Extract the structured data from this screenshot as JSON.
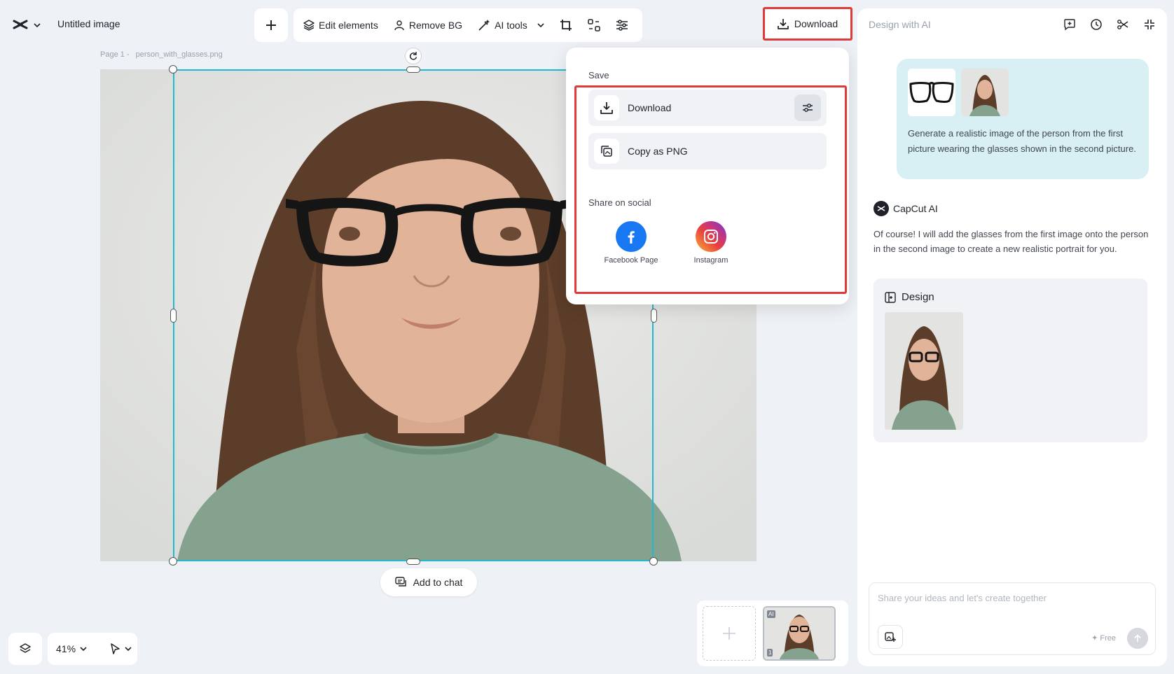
{
  "header": {
    "title": "Untitled image",
    "toolbar": {
      "edit_elements": "Edit elements",
      "remove_bg": "Remove BG",
      "ai_tools": "AI tools"
    },
    "download_label": "Download"
  },
  "canvas": {
    "page_label": "Page 1 -",
    "file_name": "person_with_glasses.png",
    "add_to_chat": "Add to chat"
  },
  "bottom": {
    "zoom": "41%"
  },
  "thumbs": {
    "badge_ai": "AI",
    "badge_num": "1"
  },
  "download_menu": {
    "save_heading": "Save",
    "download": "Download",
    "copy_png": "Copy as PNG",
    "share_heading": "Share on social",
    "facebook": "Facebook Page",
    "instagram": "Instagram"
  },
  "panel": {
    "title": "Design with AI",
    "user_message": "Generate a realistic image of the person from the first picture wearing the glasses shown in the second picture.",
    "ai_name": "CapCut AI",
    "ai_message": "Of course! I will add the glasses from the first image onto the person in the second image to create a new realistic portrait for you.",
    "design_label": "Design",
    "input_placeholder": "Share your ideas and let's create together",
    "free_label": "Free"
  },
  "colors": {
    "selection": "#22b8cf",
    "highlight": "#e03a3a",
    "facebook": "#1877f2"
  }
}
